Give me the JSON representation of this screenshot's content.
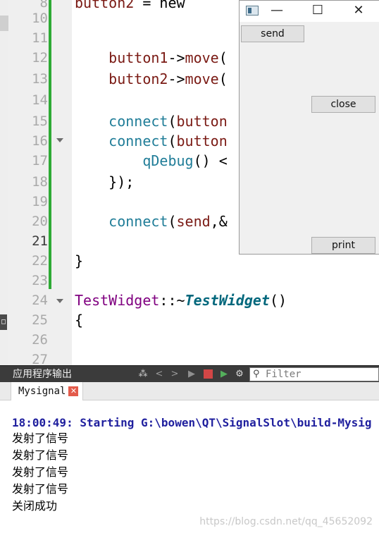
{
  "editor": {
    "current_line": "21",
    "lines": [
      {
        "num": "8",
        "tokens": [
          {
            "t": "button2",
            "c": "red"
          },
          {
            "t": " = ",
            "c": "plain"
          },
          {
            "t": "new",
            "c": "plain"
          }
        ]
      },
      {
        "num": "10",
        "tokens": []
      },
      {
        "num": "11",
        "tokens": []
      },
      {
        "num": "12",
        "tokens": [
          {
            "t": "    button1",
            "c": "red"
          },
          {
            "t": "->",
            "c": "plain"
          },
          {
            "t": "move",
            "c": "red"
          },
          {
            "t": "(",
            "c": "plain"
          }
        ]
      },
      {
        "num": "13",
        "tokens": [
          {
            "t": "    button2",
            "c": "red"
          },
          {
            "t": "->",
            "c": "plain"
          },
          {
            "t": "move",
            "c": "red"
          },
          {
            "t": "(",
            "c": "plain"
          }
        ]
      },
      {
        "num": "14",
        "tokens": []
      },
      {
        "num": "15",
        "tokens": [
          {
            "t": "    connect",
            "c": "teal"
          },
          {
            "t": "(",
            "c": "plain"
          },
          {
            "t": "button",
            "c": "red"
          }
        ]
      },
      {
        "num": "16",
        "tokens": [
          {
            "t": "    connect",
            "c": "teal"
          },
          {
            "t": "(",
            "c": "plain"
          },
          {
            "t": "button",
            "c": "red"
          }
        ]
      },
      {
        "num": "17",
        "tokens": [
          {
            "t": "        qDebug",
            "c": "teal"
          },
          {
            "t": "() <",
            "c": "plain"
          }
        ]
      },
      {
        "num": "18",
        "tokens": [
          {
            "t": "    });",
            "c": "plain"
          }
        ]
      },
      {
        "num": "19",
        "tokens": []
      },
      {
        "num": "20",
        "tokens": [
          {
            "t": "    connect",
            "c": "teal"
          },
          {
            "t": "(",
            "c": "plain"
          },
          {
            "t": "send",
            "c": "red"
          },
          {
            "t": ",&",
            "c": "plain"
          }
        ]
      },
      {
        "num": "21",
        "tokens": []
      },
      {
        "num": "22",
        "tokens": [
          {
            "t": "}",
            "c": "plain"
          }
        ]
      },
      {
        "num": "23",
        "tokens": []
      },
      {
        "num": "24",
        "tokens": [
          {
            "t": "TestWidget",
            "c": "purple"
          },
          {
            "t": "::~",
            "c": "plain"
          },
          {
            "t": "TestWidget",
            "c": "bold"
          },
          {
            "t": "()",
            "c": "plain"
          }
        ]
      },
      {
        "num": "25",
        "tokens": [
          {
            "t": "{",
            "c": "plain"
          }
        ]
      },
      {
        "num": "26",
        "tokens": []
      },
      {
        "num": "27",
        "tokens": []
      }
    ],
    "left_marker": "□"
  },
  "qt_window": {
    "minimize_glyph": "—",
    "maximize_glyph": "☐",
    "close_glyph": "✕",
    "send_label": "send",
    "close_label": "close",
    "print_label": "print"
  },
  "output": {
    "pane_title": "应用程序输出",
    "tab_label": "Mysignal",
    "tab_close_glyph": "✕",
    "filter_placeholder": "Filter",
    "filter_icon": "magnifier-icon",
    "lines": [
      {
        "text": "18:00:49: Starting G:\\bowen\\QT\\SignalSlot\\build-Mysig",
        "kind": "status"
      },
      {
        "text": "发射了信号",
        "kind": "normal"
      },
      {
        "text": "发射了信号",
        "kind": "normal"
      },
      {
        "text": "发射了信号",
        "kind": "normal"
      },
      {
        "text": "发射了信号",
        "kind": "normal"
      },
      {
        "text": "关闭成功",
        "kind": "normal"
      }
    ],
    "watermark": "https://blog.csdn.net/qq_45652092"
  },
  "colors": {
    "keyword_red": "#7a1a14",
    "keyword_teal": "#207d98",
    "class_purple": "#800080",
    "change_bar_green": "#2eaa35",
    "status_blue": "#1f1f9e",
    "stop_red": "#d24646"
  }
}
